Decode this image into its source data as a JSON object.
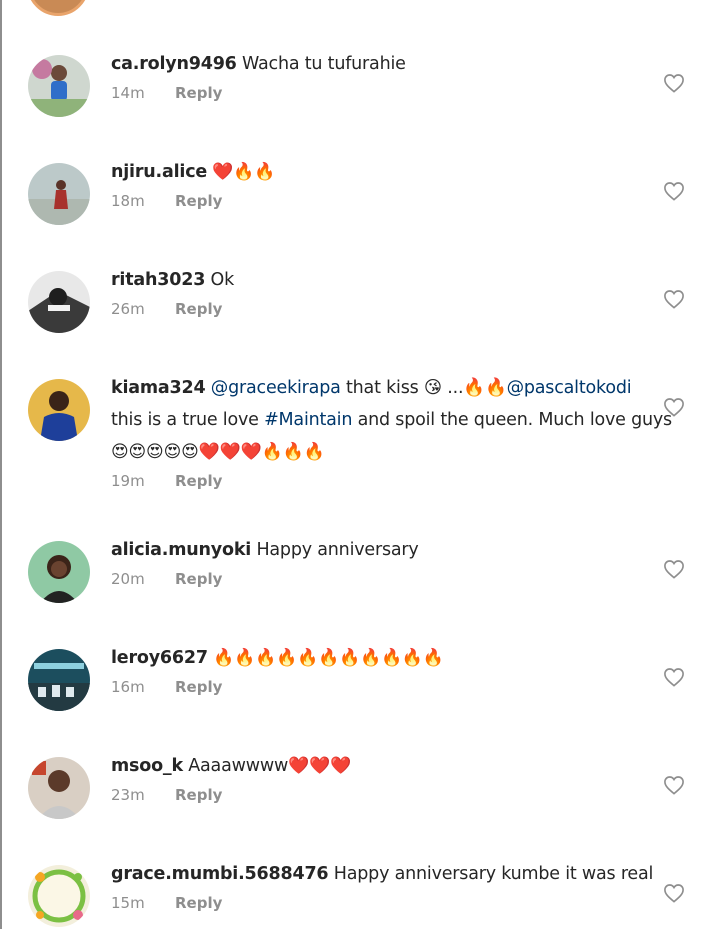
{
  "reply_label": "Reply",
  "colors": {
    "text": "#262626",
    "meta": "#8e8e8e",
    "link": "#00376b",
    "red_heart": "#e0243a"
  },
  "comments": [
    {
      "username": "ca.rolyn9496",
      "text": "Wacha tu tufurahie",
      "time": "14m"
    },
    {
      "username": "njiru.alice",
      "text": "",
      "emoji": "❤️🔥🔥",
      "time": "18m"
    },
    {
      "username": "ritah3023",
      "text": "Ok",
      "time": "26m"
    },
    {
      "username": "kiama324",
      "mention1": "@graceekirapa",
      "text1": " that kiss 😘 ...🔥🔥",
      "mention2": "@pascaltokodi",
      "text2a": "this is a true love ",
      "hashtag": "#Maintain",
      "text2b": "  and spoil the queen. Much love guys",
      "emoji_line": "😍😍😍😍😍❤️❤️❤️🔥🔥🔥",
      "time": "19m"
    },
    {
      "username": "alicia.munyoki",
      "text": "Happy anniversary",
      "time": "20m"
    },
    {
      "username": "leroy6627",
      "text": "",
      "emoji": "🔥🔥🔥🔥🔥🔥🔥🔥🔥🔥🔥",
      "time": "16m"
    },
    {
      "username": "msoo_k",
      "text": "Aaaawwww",
      "emoji": "❤️❤️❤️",
      "time": "23m"
    },
    {
      "username": "grace.mumbi.5688476",
      "text": "Happy anniversary kumbe it was real",
      "time": "15m"
    }
  ],
  "icons": {
    "like": "heart-outline-icon"
  }
}
